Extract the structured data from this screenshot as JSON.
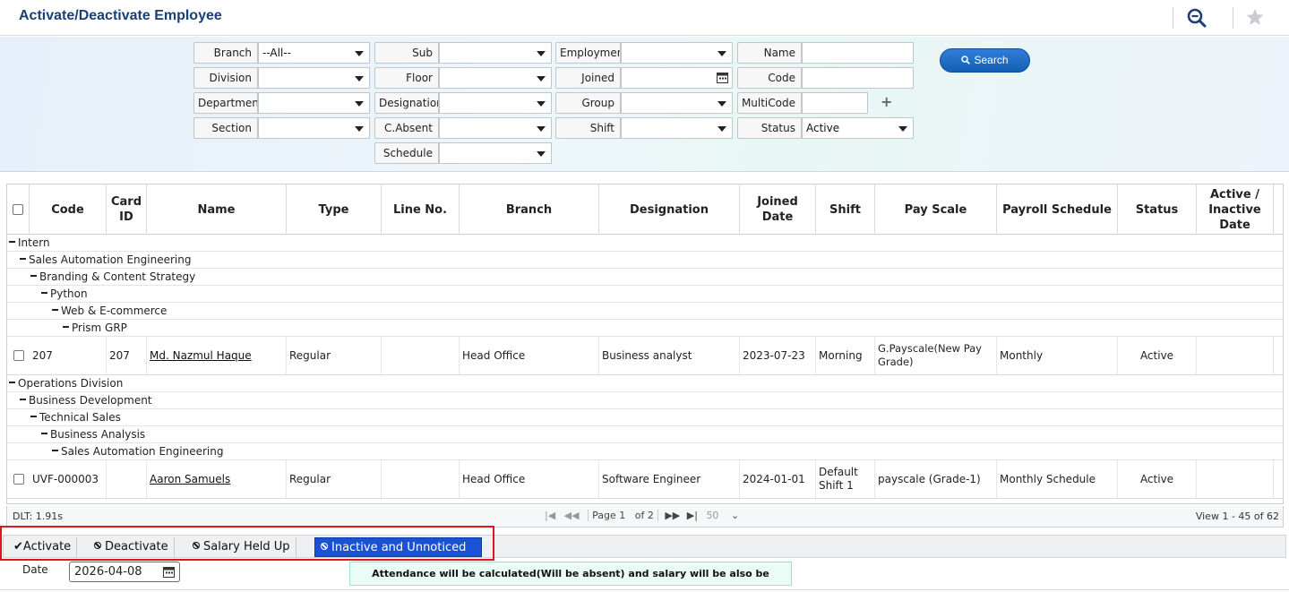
{
  "header": {
    "title": "Activate/Deactivate Employee",
    "zoom_icon": "zoom-out-icon",
    "fav_icon": "star-icon"
  },
  "filters": {
    "branch": {
      "label": "Branch",
      "value": "--All--"
    },
    "sub": {
      "label": "Sub",
      "value": ""
    },
    "employment": {
      "label": "Employmen",
      "value": ""
    },
    "name": {
      "label": "Name",
      "value": ""
    },
    "division": {
      "label": "Division",
      "value": ""
    },
    "floor": {
      "label": "Floor",
      "value": ""
    },
    "joined": {
      "label": "Joined",
      "value": ""
    },
    "code": {
      "label": "Code",
      "value": ""
    },
    "department": {
      "label": "Department",
      "value": ""
    },
    "designation": {
      "label": "Designation",
      "value": ""
    },
    "group": {
      "label": "Group",
      "value": ""
    },
    "multicode": {
      "label": "MultiCode",
      "value": ""
    },
    "section": {
      "label": "Section",
      "value": ""
    },
    "cabsent": {
      "label": "C.Absent",
      "value": ""
    },
    "shift": {
      "label": "Shift",
      "value": ""
    },
    "status": {
      "label": "Status",
      "value": "Active"
    },
    "schedule": {
      "label": "Schedule",
      "value": ""
    },
    "add": "+",
    "search_label": "Search"
  },
  "grid": {
    "headers": [
      "Code",
      "Card ID",
      "Name",
      "Type",
      "Line No.",
      "Branch",
      "Designation",
      "Joined Date",
      "Shift",
      "Pay Scale",
      "Payroll Schedule",
      "Status",
      "Active / Inactive Date"
    ],
    "groups1": [
      "Intern",
      "Sales Automation Engineering",
      "Branding & Content Strategy",
      "Python",
      "Web & E-commerce",
      "Prism GRP"
    ],
    "row1": {
      "code": "207",
      "card_id": "207",
      "name": "Md. Nazmul Haque",
      "type": "Regular",
      "line_no": "",
      "branch": "Head Office",
      "designation": "Business analyst",
      "joined": "2023-07-23",
      "shift": "Morning",
      "pay_scale": "G.Payscale(New Pay Grade)",
      "payroll_schedule": "Monthly",
      "status": "Active",
      "date": ""
    },
    "groups2": [
      "Operations Division",
      "Business Development",
      "Technical Sales",
      "Business Analysis",
      "Sales Automation Engineering"
    ],
    "row2": {
      "code": "UVF-000003",
      "card_id": "",
      "name": "Aaron Samuels",
      "type": "Regular",
      "line_no": "",
      "branch": "Head Office",
      "designation": "Software Engineer",
      "joined": "2024-01-01",
      "shift": "Default Shift 1",
      "pay_scale": "payscale (Grade-1)",
      "payroll_schedule": "Monthly Schedule",
      "status": "Active",
      "date": ""
    }
  },
  "pager": {
    "dlt": "DLT: 1.91s",
    "page_label": "Page",
    "page": "1",
    "of": "of 2",
    "page_size": "50",
    "view_info": "View 1 - 45 of 62"
  },
  "actions": {
    "activate": "Activate",
    "deactivate": "Deactivate",
    "salary_held": "Salary Held Up",
    "inactive_unnoticed": "Inactive and Unnoticed"
  },
  "date_field": {
    "label": "Date",
    "value": "2026-04-08"
  },
  "notice": "Attendance will be calculated(Will be absent) and salary will be also be calculated!"
}
